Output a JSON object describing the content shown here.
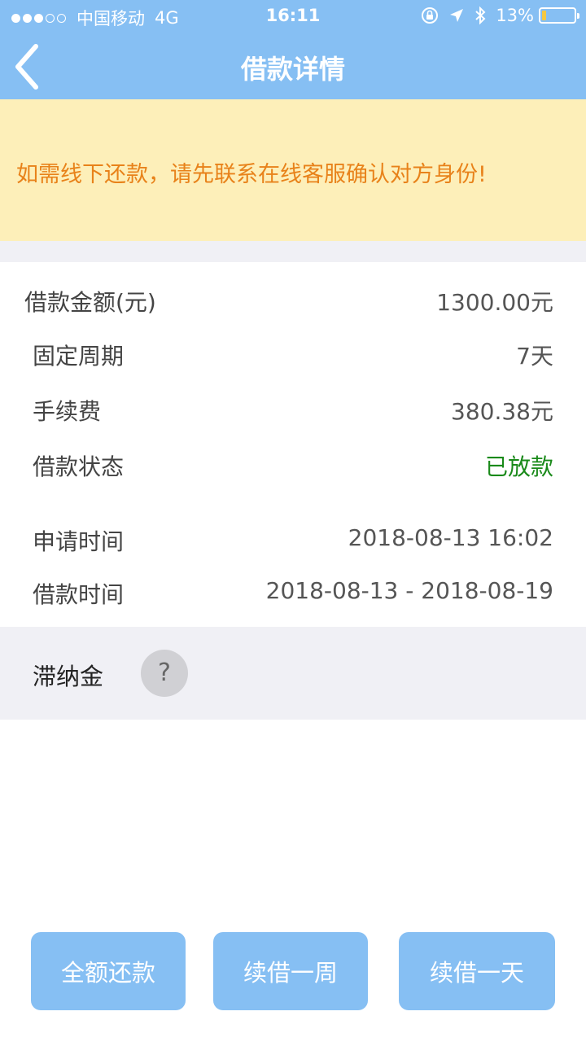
{
  "status_bar": {
    "signal_dots": [
      true,
      true,
      true,
      false,
      false
    ],
    "carrier": "中国移动",
    "network": "4G",
    "time": "16:11",
    "battery_text": "13%",
    "battery_level": 0.13
  },
  "nav": {
    "title": "借款详情",
    "back_icon": "chevron-left-icon"
  },
  "notice": {
    "text": "如需线下还款，请先联系在线客服确认对方身份!"
  },
  "details": [
    {
      "label": "借款金额(元)",
      "value": "1300.00元"
    },
    {
      "label": "固定周期",
      "value": "7天"
    },
    {
      "label": "手续费",
      "value": "380.38元"
    },
    {
      "label": "借款状态",
      "value": "已放款"
    },
    {
      "label": "申请时间",
      "value": "2018-08-13 16:02"
    },
    {
      "label": "借款时间",
      "value": "2018-08-13 - 2018-08-19"
    }
  ],
  "late_fee": {
    "label": "滞纳金",
    "help_glyph": "?"
  },
  "buttons": {
    "repay_full": "全额还款",
    "renew_week": "续借一周",
    "renew_day": "续借一天"
  },
  "colors": {
    "nav_bg": "#86bff3",
    "notice_bg": "#fdefb9",
    "notice_text": "#e8821a",
    "status_green": "#1a8a1a"
  }
}
